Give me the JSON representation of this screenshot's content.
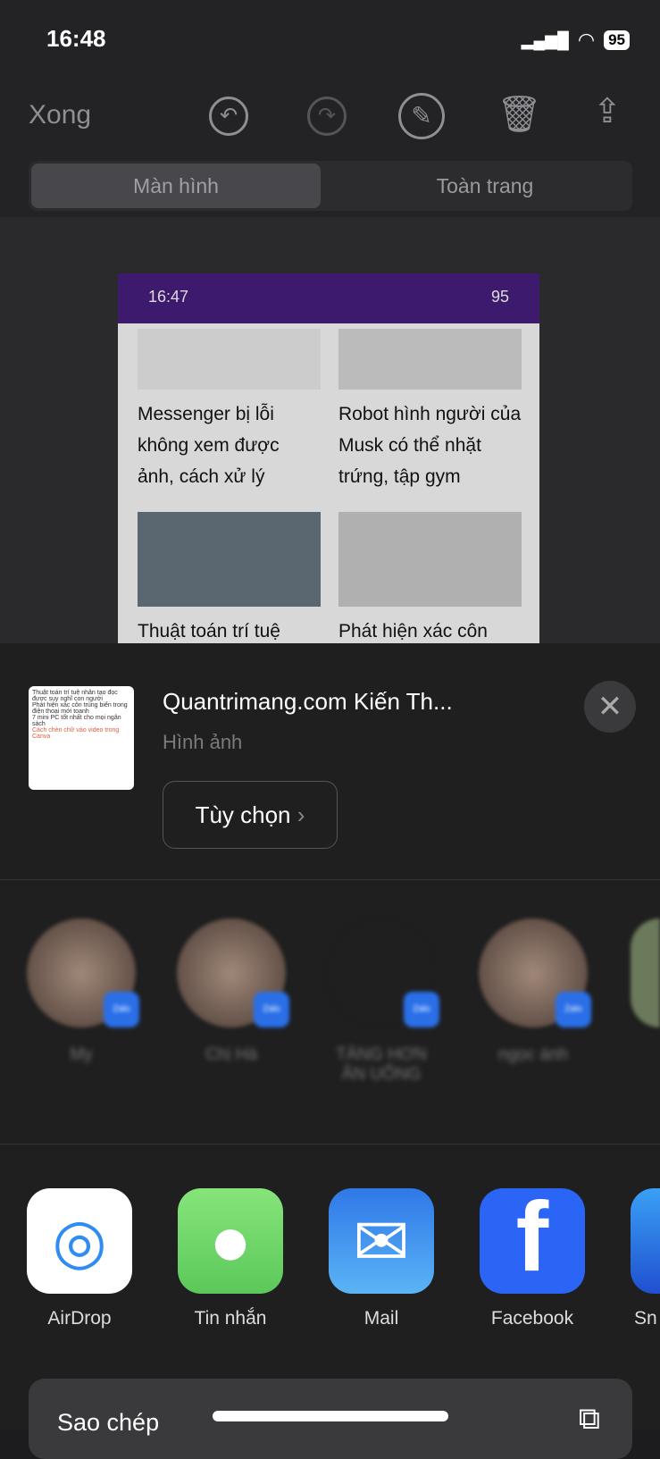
{
  "status_bar": {
    "time": "16:48",
    "battery": "95"
  },
  "toolbar": {
    "done": "Xong",
    "icons": [
      "undo-icon",
      "redo-icon",
      "markup-pen-icon",
      "trash-icon",
      "share-icon"
    ]
  },
  "segments": {
    "screen": "Màn hình",
    "full_page": "Toàn trang"
  },
  "preview": {
    "time": "16:47",
    "battery": "95",
    "articles": [
      {
        "title": "Messenger bị lỗi không xem được ảnh, cách xử lý"
      },
      {
        "title": "Robot hình người của Musk có thể nhặt trứng, tập gym"
      },
      {
        "title": "Thuật toán trí tuệ"
      },
      {
        "title": "Phát hiện xác côn"
      }
    ]
  },
  "share": {
    "title": "Quantrimang.com Kiến Th...",
    "subtitle": "Hình ảnh",
    "options": "Tùy chọn",
    "thumb_texts": [
      "Thuật toán trí tuệ nhân tạo đọc được suy nghĩ con người",
      "Phát hiện xác côn trùng biển trong điện thoại mới toanh",
      "7 mini PC tốt nhất cho mọi ngân sách",
      "Cách chèn chữ vào video trong Canva"
    ]
  },
  "contacts": [
    {
      "name": "My"
    },
    {
      "name": "Chị Hà"
    },
    {
      "name": "TĂNG HƠN ĂN UỐNG"
    },
    {
      "name": "ngọc ánh"
    }
  ],
  "contact_badge": "Zalo",
  "apps": [
    {
      "label": "AirDrop",
      "color": "#ffffff"
    },
    {
      "label": "Tin nhắn",
      "color": "#5cc85a"
    },
    {
      "label": "Mail",
      "color": "#3d8ef0"
    },
    {
      "label": "Facebook",
      "color": "#2a65f5"
    },
    {
      "label": "Sn"
    }
  ],
  "actions": [
    {
      "label": "Sao chép",
      "icon": "copy-icon"
    }
  ]
}
